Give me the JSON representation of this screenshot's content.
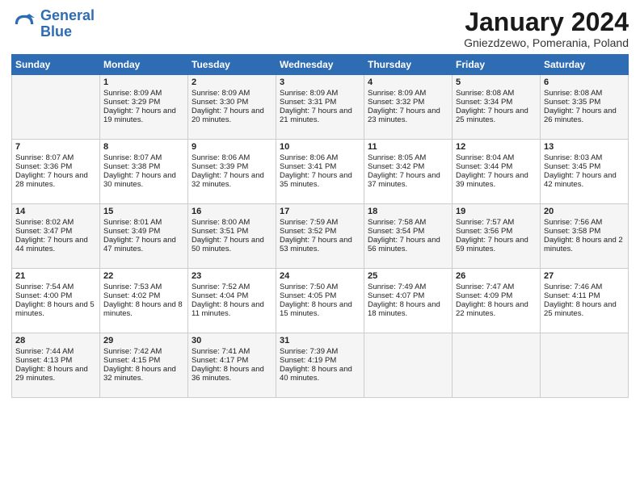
{
  "logo": {
    "line1": "General",
    "line2": "Blue"
  },
  "title": "January 2024",
  "subtitle": "Gniezdzewo, Pomerania, Poland",
  "days_of_week": [
    "Sunday",
    "Monday",
    "Tuesday",
    "Wednesday",
    "Thursday",
    "Friday",
    "Saturday"
  ],
  "weeks": [
    [
      {
        "day": "",
        "sunrise": "",
        "sunset": "",
        "daylight": ""
      },
      {
        "day": "1",
        "sunrise": "Sunrise: 8:09 AM",
        "sunset": "Sunset: 3:29 PM",
        "daylight": "Daylight: 7 hours and 19 minutes."
      },
      {
        "day": "2",
        "sunrise": "Sunrise: 8:09 AM",
        "sunset": "Sunset: 3:30 PM",
        "daylight": "Daylight: 7 hours and 20 minutes."
      },
      {
        "day": "3",
        "sunrise": "Sunrise: 8:09 AM",
        "sunset": "Sunset: 3:31 PM",
        "daylight": "Daylight: 7 hours and 21 minutes."
      },
      {
        "day": "4",
        "sunrise": "Sunrise: 8:09 AM",
        "sunset": "Sunset: 3:32 PM",
        "daylight": "Daylight: 7 hours and 23 minutes."
      },
      {
        "day": "5",
        "sunrise": "Sunrise: 8:08 AM",
        "sunset": "Sunset: 3:34 PM",
        "daylight": "Daylight: 7 hours and 25 minutes."
      },
      {
        "day": "6",
        "sunrise": "Sunrise: 8:08 AM",
        "sunset": "Sunset: 3:35 PM",
        "daylight": "Daylight: 7 hours and 26 minutes."
      }
    ],
    [
      {
        "day": "7",
        "sunrise": "Sunrise: 8:07 AM",
        "sunset": "Sunset: 3:36 PM",
        "daylight": "Daylight: 7 hours and 28 minutes."
      },
      {
        "day": "8",
        "sunrise": "Sunrise: 8:07 AM",
        "sunset": "Sunset: 3:38 PM",
        "daylight": "Daylight: 7 hours and 30 minutes."
      },
      {
        "day": "9",
        "sunrise": "Sunrise: 8:06 AM",
        "sunset": "Sunset: 3:39 PM",
        "daylight": "Daylight: 7 hours and 32 minutes."
      },
      {
        "day": "10",
        "sunrise": "Sunrise: 8:06 AM",
        "sunset": "Sunset: 3:41 PM",
        "daylight": "Daylight: 7 hours and 35 minutes."
      },
      {
        "day": "11",
        "sunrise": "Sunrise: 8:05 AM",
        "sunset": "Sunset: 3:42 PM",
        "daylight": "Daylight: 7 hours and 37 minutes."
      },
      {
        "day": "12",
        "sunrise": "Sunrise: 8:04 AM",
        "sunset": "Sunset: 3:44 PM",
        "daylight": "Daylight: 7 hours and 39 minutes."
      },
      {
        "day": "13",
        "sunrise": "Sunrise: 8:03 AM",
        "sunset": "Sunset: 3:45 PM",
        "daylight": "Daylight: 7 hours and 42 minutes."
      }
    ],
    [
      {
        "day": "14",
        "sunrise": "Sunrise: 8:02 AM",
        "sunset": "Sunset: 3:47 PM",
        "daylight": "Daylight: 7 hours and 44 minutes."
      },
      {
        "day": "15",
        "sunrise": "Sunrise: 8:01 AM",
        "sunset": "Sunset: 3:49 PM",
        "daylight": "Daylight: 7 hours and 47 minutes."
      },
      {
        "day": "16",
        "sunrise": "Sunrise: 8:00 AM",
        "sunset": "Sunset: 3:51 PM",
        "daylight": "Daylight: 7 hours and 50 minutes."
      },
      {
        "day": "17",
        "sunrise": "Sunrise: 7:59 AM",
        "sunset": "Sunset: 3:52 PM",
        "daylight": "Daylight: 7 hours and 53 minutes."
      },
      {
        "day": "18",
        "sunrise": "Sunrise: 7:58 AM",
        "sunset": "Sunset: 3:54 PM",
        "daylight": "Daylight: 7 hours and 56 minutes."
      },
      {
        "day": "19",
        "sunrise": "Sunrise: 7:57 AM",
        "sunset": "Sunset: 3:56 PM",
        "daylight": "Daylight: 7 hours and 59 minutes."
      },
      {
        "day": "20",
        "sunrise": "Sunrise: 7:56 AM",
        "sunset": "Sunset: 3:58 PM",
        "daylight": "Daylight: 8 hours and 2 minutes."
      }
    ],
    [
      {
        "day": "21",
        "sunrise": "Sunrise: 7:54 AM",
        "sunset": "Sunset: 4:00 PM",
        "daylight": "Daylight: 8 hours and 5 minutes."
      },
      {
        "day": "22",
        "sunrise": "Sunrise: 7:53 AM",
        "sunset": "Sunset: 4:02 PM",
        "daylight": "Daylight: 8 hours and 8 minutes."
      },
      {
        "day": "23",
        "sunrise": "Sunrise: 7:52 AM",
        "sunset": "Sunset: 4:04 PM",
        "daylight": "Daylight: 8 hours and 11 minutes."
      },
      {
        "day": "24",
        "sunrise": "Sunrise: 7:50 AM",
        "sunset": "Sunset: 4:05 PM",
        "daylight": "Daylight: 8 hours and 15 minutes."
      },
      {
        "day": "25",
        "sunrise": "Sunrise: 7:49 AM",
        "sunset": "Sunset: 4:07 PM",
        "daylight": "Daylight: 8 hours and 18 minutes."
      },
      {
        "day": "26",
        "sunrise": "Sunrise: 7:47 AM",
        "sunset": "Sunset: 4:09 PM",
        "daylight": "Daylight: 8 hours and 22 minutes."
      },
      {
        "day": "27",
        "sunrise": "Sunrise: 7:46 AM",
        "sunset": "Sunset: 4:11 PM",
        "daylight": "Daylight: 8 hours and 25 minutes."
      }
    ],
    [
      {
        "day": "28",
        "sunrise": "Sunrise: 7:44 AM",
        "sunset": "Sunset: 4:13 PM",
        "daylight": "Daylight: 8 hours and 29 minutes."
      },
      {
        "day": "29",
        "sunrise": "Sunrise: 7:42 AM",
        "sunset": "Sunset: 4:15 PM",
        "daylight": "Daylight: 8 hours and 32 minutes."
      },
      {
        "day": "30",
        "sunrise": "Sunrise: 7:41 AM",
        "sunset": "Sunset: 4:17 PM",
        "daylight": "Daylight: 8 hours and 36 minutes."
      },
      {
        "day": "31",
        "sunrise": "Sunrise: 7:39 AM",
        "sunset": "Sunset: 4:19 PM",
        "daylight": "Daylight: 8 hours and 40 minutes."
      },
      {
        "day": "",
        "sunrise": "",
        "sunset": "",
        "daylight": ""
      },
      {
        "day": "",
        "sunrise": "",
        "sunset": "",
        "daylight": ""
      },
      {
        "day": "",
        "sunrise": "",
        "sunset": "",
        "daylight": ""
      }
    ]
  ]
}
